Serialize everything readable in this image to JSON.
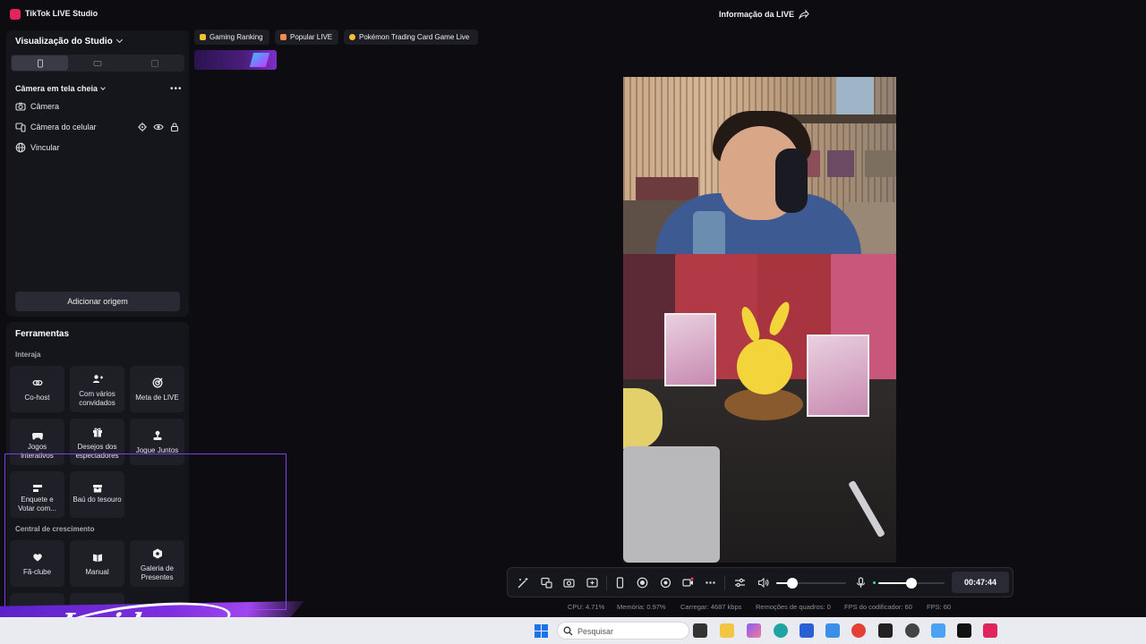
{
  "window": {
    "app_title": "TikTok LIVE Studio",
    "live_info_label": "Informação da LIVE"
  },
  "studio_panel": {
    "title": "Visualização do Studio",
    "orientations": [
      "portrait",
      "landscape",
      "dual"
    ],
    "active_orientation": "portrait",
    "scene_name": "Câmera em tela cheia",
    "more_label": "•••",
    "sources": [
      {
        "label": "Câmera",
        "icon": "camera-icon"
      },
      {
        "label": "Câmera do celular",
        "icon": "phone-camera-icon"
      },
      {
        "label": "Vincular",
        "icon": "globe-icon"
      }
    ],
    "add_source_label": "Adicionar origem"
  },
  "tools_panel": {
    "title": "Ferramentas",
    "interact_label": "Interaja",
    "interact_tools": [
      {
        "label": "Co-host",
        "icon": "link-icon"
      },
      {
        "label": "Com vários convidados",
        "icon": "multi-guest-icon"
      },
      {
        "label": "Meta de LIVE",
        "icon": "target-icon"
      },
      {
        "label": "Jogos interativos",
        "icon": "gamepad-icon"
      },
      {
        "label": "Desejos dos espectadores",
        "icon": "gift-icon"
      },
      {
        "label": "Jogue Juntos",
        "icon": "joystick-icon"
      },
      {
        "label": "Enquete e Votar com...",
        "icon": "poll-icon"
      },
      {
        "label": "Baú do tesouro",
        "icon": "chest-icon"
      }
    ],
    "growth_label": "Central de crescimento",
    "growth_tools": [
      {
        "label": "Fã-clube",
        "icon": "heart-icon"
      },
      {
        "label": "Manual",
        "icon": "book-icon"
      },
      {
        "label": "Galeria de Presentes",
        "icon": "gift-gallery-icon"
      }
    ]
  },
  "ranking_tags": [
    {
      "label": "Gaming Ranking",
      "color": "#f2c12e"
    },
    {
      "label": "Popular LIVE",
      "color": "#ff8a4c"
    },
    {
      "label": "Pokémon Trading Card Game Live",
      "color": "#f2c12e"
    }
  ],
  "control_bar": {
    "timer": "00:47:44",
    "speaker_volume": 0.23,
    "mic_volume": 0.5
  },
  "stats": {
    "cpu": "CPU: 4.71%",
    "memory": "Memória: 0.97%",
    "upload": "Carregar: 4687 kbps",
    "dropped": "Remoções de quadros: 0",
    "encoder_fps": "FPS do codificador: 60",
    "fps": "FPS: 60"
  },
  "taskbar": {
    "search_placeholder": "Pesquisar"
  },
  "watermark": {
    "brand": "Insider"
  },
  "colors": {
    "background": "#0c0c11",
    "panel": "#15151c",
    "accent_purple": "#7e3ee8",
    "tiktok_pink": "#e0245e"
  }
}
